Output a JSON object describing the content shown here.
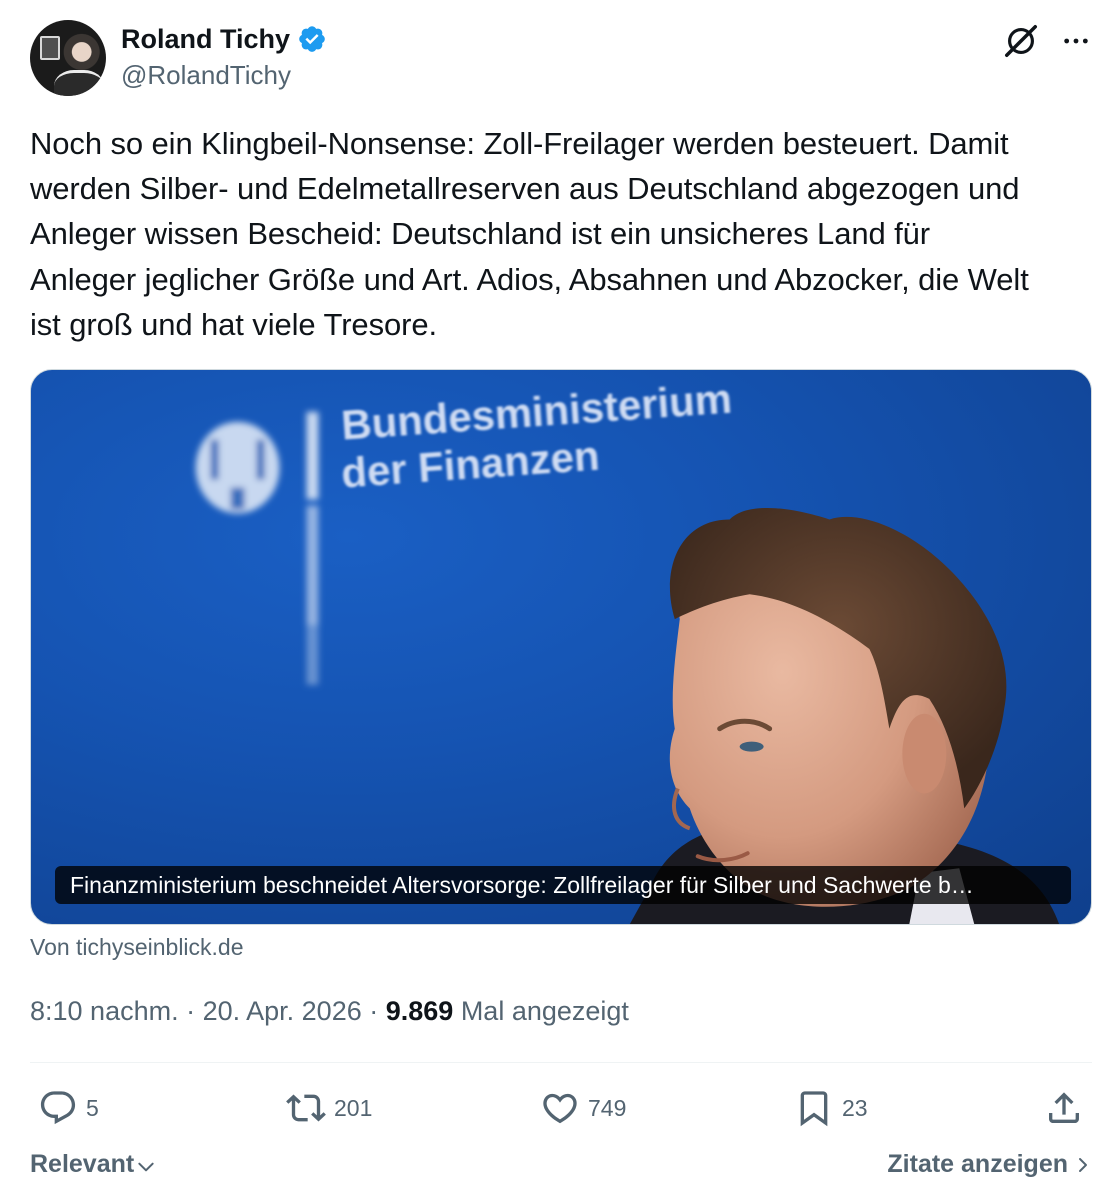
{
  "author": {
    "name": "Roland Tichy",
    "handle": "@RolandTichy"
  },
  "tweet": {
    "text": "Noch so ein Klingbeil-Nonsense: Zoll-Freilager werden besteuert. Damit\nwerden Silber- und Edelmetallreserven aus Deutschland abgezogen und\nAnleger wissen Bescheid: Deutschland ist ein unsicheres Land für\nAnleger jeglicher Größe und Art. Adios, Absahnen und Abzocker, die Welt\nist groß und hat viele Tresore."
  },
  "card": {
    "sign_line1": "Bundesministerium",
    "sign_line2": "der Finanzen",
    "caption": "Finanzministerium beschneidet Altersvorsorge: Zollfreilager für Silber und Sachwerte b…",
    "source": "Von tichyseinblick.de"
  },
  "meta": {
    "time": "8:10 nachm.",
    "separator": " · ",
    "date": "20. Apr. 2026",
    "views_count": "9.869",
    "views_label": " Mal angezeigt"
  },
  "actions": {
    "replies": "5",
    "reposts": "201",
    "likes": "749",
    "bookmarks": "23"
  },
  "footer": {
    "sort_label": "Relevant",
    "quotes_label": "Zitate anzeigen"
  },
  "colors": {
    "text_primary": "#0f1419",
    "text_secondary": "#536471",
    "verified_blue": "#1d9bf0",
    "card_blue": "#1553b1"
  },
  "icons": [
    "verified-badge-icon",
    "grok-icon",
    "more-icon",
    "reply-icon",
    "repost-icon",
    "like-icon",
    "bookmark-icon",
    "share-icon",
    "chevron-down-icon",
    "chevron-right-icon"
  ]
}
